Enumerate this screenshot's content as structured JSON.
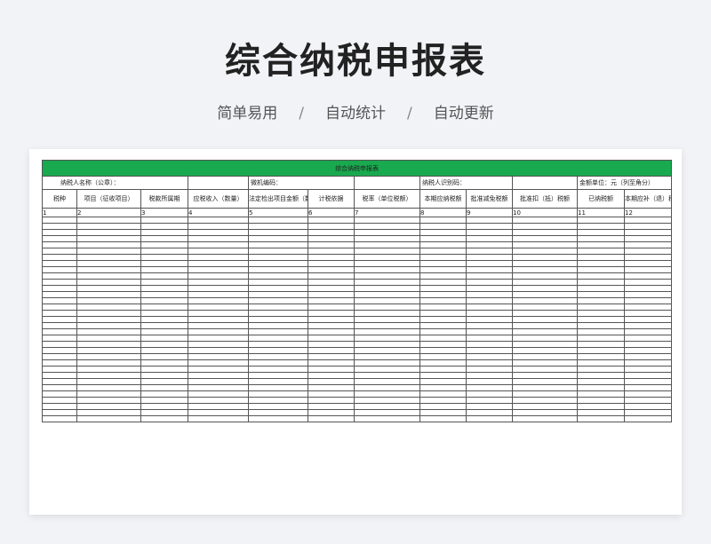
{
  "page": {
    "title": "综合纳税申报表",
    "tagline": [
      "简单易用",
      "自动统计",
      "自动更新"
    ],
    "tagline_separator": "/"
  },
  "sheet": {
    "title": "综合纳税申报表",
    "accent_color": "#19a94e",
    "info": {
      "taxpayer_name": "纳税人名称（公章）：",
      "computer_code": "微机编码：",
      "taxpayer_id": "纳税人识别码：",
      "amount_unit": "金额单位：元（列至角分）"
    },
    "columns": [
      "税种",
      "项目（征收项目）",
      "税款所属期",
      "应税收入（数量）",
      "法定检出项目金额（数量）",
      "计税依据",
      "税率（单位税额）",
      "本期应纳税额",
      "批准减免税额",
      "批准扣（抵）税额",
      "已纳税额",
      "本期应补（退）税额"
    ],
    "column_numbers": [
      "1",
      "2",
      "3",
      "4",
      "5",
      "6",
      "7",
      "8",
      "9",
      "10",
      "11",
      "12"
    ],
    "blank_row_count": 33
  }
}
